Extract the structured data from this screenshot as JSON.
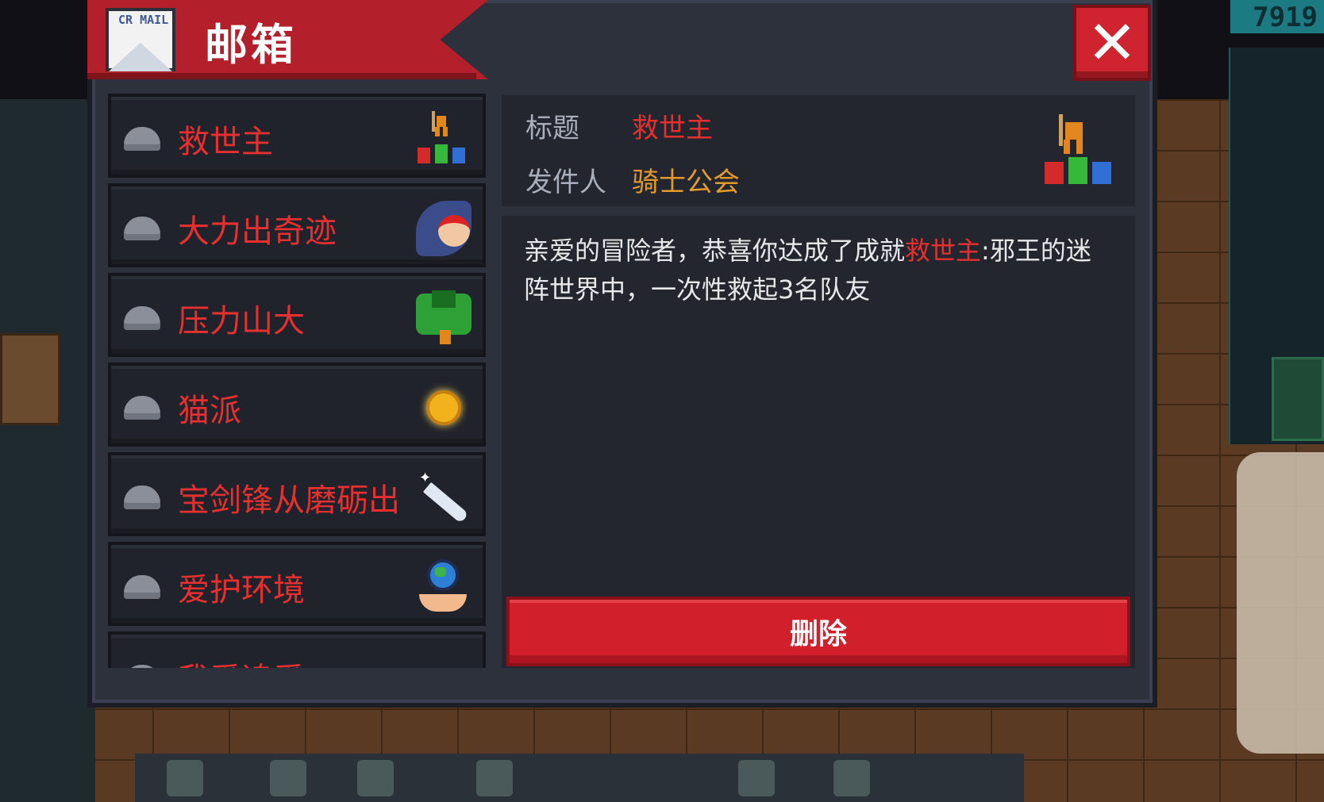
{
  "window": {
    "title": "邮箱",
    "mail_icon_text": "CR MAIL",
    "close_symbol": "✕"
  },
  "background": {
    "score_text": "7919"
  },
  "mail_list": [
    {
      "title": "救世主",
      "icon": "savior-trophy-icon"
    },
    {
      "title": "大力出奇迹",
      "icon": "strength-character-icon"
    },
    {
      "title": "压力山大",
      "icon": "pressure-boss-icon"
    },
    {
      "title": "猫派",
      "icon": "gold-coin-icon"
    },
    {
      "title": "宝剑锋从磨砺出",
      "icon": "sword-icon"
    },
    {
      "title": "爱护环境",
      "icon": "earth-hands-icon"
    },
    {
      "title": "我爱追爱",
      "icon": "partial-icon"
    }
  ],
  "detail": {
    "title_label": "标题",
    "title_value": "救世主",
    "sender_label": "发件人",
    "sender_value": "骑士公会",
    "body_prefix": "亲爱的冒险者，恭喜你达成了成就",
    "body_highlight": "救世主",
    "body_suffix": ":邪王的迷阵世界中，一次性救起3名队友",
    "delete_label": "删除"
  },
  "colors": {
    "title_bar": "#b3202b",
    "highlight_red": "#e5302f",
    "sender_orange": "#e39a28",
    "panel_bg": "#2c313c",
    "card_bg": "#23262e"
  }
}
